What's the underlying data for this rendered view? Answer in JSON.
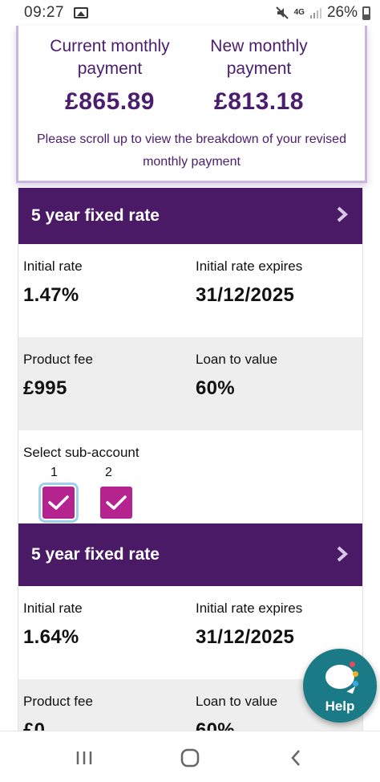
{
  "status_bar": {
    "time": "09:27",
    "network": "4G",
    "battery": "26%"
  },
  "summary": {
    "current_label": "Current monthly payment",
    "current_value": "£865.89",
    "new_label": "New monthly payment",
    "new_value": "£813.18",
    "note": "Please scroll up to view the breakdown of your revised monthly payment"
  },
  "accounts": [
    {
      "title": "5 year fixed rate",
      "initial_rate_label": "Initial rate",
      "initial_rate": "1.47%",
      "expires_label": "Initial rate expires",
      "expires": "31/12/2025",
      "fee_label": "Product fee",
      "fee": "£995",
      "ltv_label": "Loan to value",
      "ltv": "60%"
    },
    {
      "title": "5 year fixed rate",
      "initial_rate_label": "Initial rate",
      "initial_rate": "1.64%",
      "expires_label": "Initial rate expires",
      "expires": "31/12/2025",
      "fee_label": "Product fee",
      "fee": "£0",
      "ltv_label": "Loan to value",
      "ltv": "60%"
    }
  ],
  "sub_account": {
    "label": "Select sub-account",
    "options": [
      {
        "number": "1",
        "checked": true
      },
      {
        "number": "2",
        "checked": true
      }
    ]
  },
  "help": {
    "label": "Help"
  },
  "colors": {
    "brand_purple": "#4b1a66",
    "checkbox_magenta": "#b5238f",
    "help_teal": "#1a7a85"
  },
  "icons": [
    "image-icon",
    "mute-icon",
    "signal-icon",
    "battery-icon",
    "chevron-right-icon",
    "checkmark-icon",
    "chat-bubble-icon",
    "recent-apps-icon",
    "home-icon",
    "back-icon"
  ]
}
